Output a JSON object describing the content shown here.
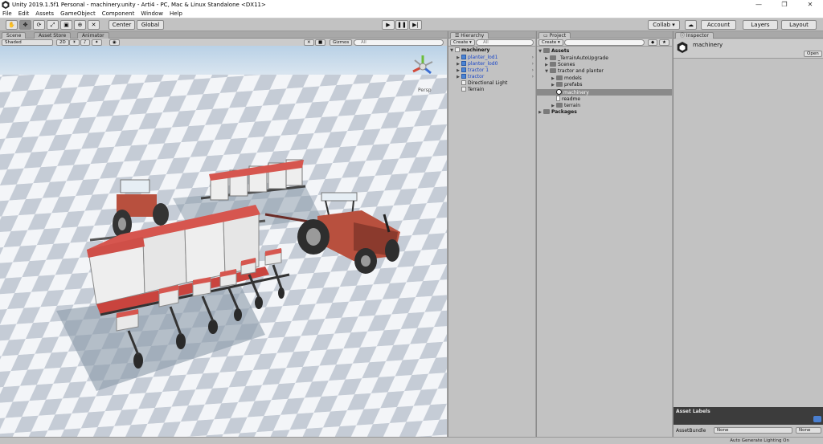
{
  "window": {
    "title": "Unity 2019.1.5f1 Personal - machinery.unity - Arti4 - PC, Mac & Linux Standalone <DX11>",
    "controls": [
      "—",
      "❐",
      "✕"
    ]
  },
  "menu": [
    "File",
    "Edit",
    "Assets",
    "GameObject",
    "Component",
    "Window",
    "Help"
  ],
  "toolbar": {
    "pivot": "Center",
    "space": "Global",
    "collab": "Collab ▾",
    "account": "Account",
    "layers": "Layers",
    "layout": "Layout"
  },
  "scene": {
    "tabs": [
      "Scene",
      "Asset Store",
      "Animator"
    ],
    "shading": "Shaded",
    "mode2d": "2D",
    "gizmos": "Gizmos",
    "search_placeholder": "All",
    "persp": "Persp"
  },
  "hierarchy": {
    "tab": "Hierarchy",
    "create": "Create ▾",
    "search_placeholder": "All",
    "root": "machinery",
    "items": [
      {
        "label": "planter_lod1",
        "prefab": true
      },
      {
        "label": "planter_lod0",
        "prefab": true
      },
      {
        "label": "tractor 1",
        "prefab": true
      },
      {
        "label": "tractor",
        "prefab": true
      },
      {
        "label": "Directional Light",
        "prefab": false
      },
      {
        "label": "Terrain",
        "prefab": false
      }
    ]
  },
  "project": {
    "tab": "Project",
    "create": "Create ▾",
    "root": "Assets",
    "items": [
      {
        "label": "_TerrainAutoUpgrade",
        "depth": 1
      },
      {
        "label": "Scenes",
        "depth": 1
      },
      {
        "label": "tractor and planter",
        "depth": 1
      },
      {
        "label": "models",
        "depth": 2
      },
      {
        "label": "prefabs",
        "depth": 2
      },
      {
        "label": "machinery",
        "depth": 2,
        "selected": true
      },
      {
        "label": "readme",
        "depth": 2
      },
      {
        "label": "terrain",
        "depth": 2
      }
    ],
    "packages": "Packages"
  },
  "inspector": {
    "tab": "Inspector",
    "object": "machinery",
    "open": "Open",
    "asset_labels": "Asset Labels",
    "asset_bundle": "AssetBundle",
    "bundle_value": "None",
    "variant_value": "None"
  },
  "status": "Auto Generate Lighting On",
  "colors": {
    "sky": "#b9d1e6",
    "tile_light": "#f3f5f8",
    "tile_dark": "#c5ccd6",
    "planter_red": "#d6564f",
    "tractor_red": "#b8503e",
    "selection": "#8a8a8a"
  }
}
